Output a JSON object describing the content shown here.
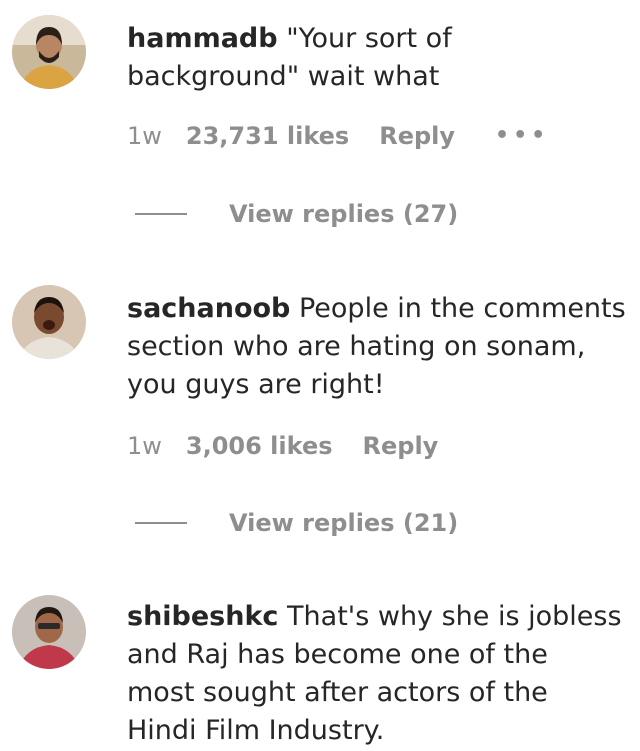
{
  "comments": [
    {
      "username": "hammadb",
      "text_lines": [
        "\"Your sort of",
        "background\" wait what"
      ],
      "time": "1w",
      "likes": "23,731 likes",
      "reply": "Reply",
      "more": "•••",
      "view_replies": "View replies (27)"
    },
    {
      "username": "sachanoob",
      "text_lines": [
        "People in the comments",
        "section who are hating on sonam,",
        "you guys are right!"
      ],
      "time": "1w",
      "likes": "3,006 likes",
      "reply": "Reply",
      "view_replies": "View replies (21)"
    },
    {
      "username": "shibeshkc",
      "text_lines": [
        "That's why she is jobless",
        "and Raj has become one of the",
        "most sought after actors of the",
        "Hindi Film Industry."
      ]
    }
  ]
}
